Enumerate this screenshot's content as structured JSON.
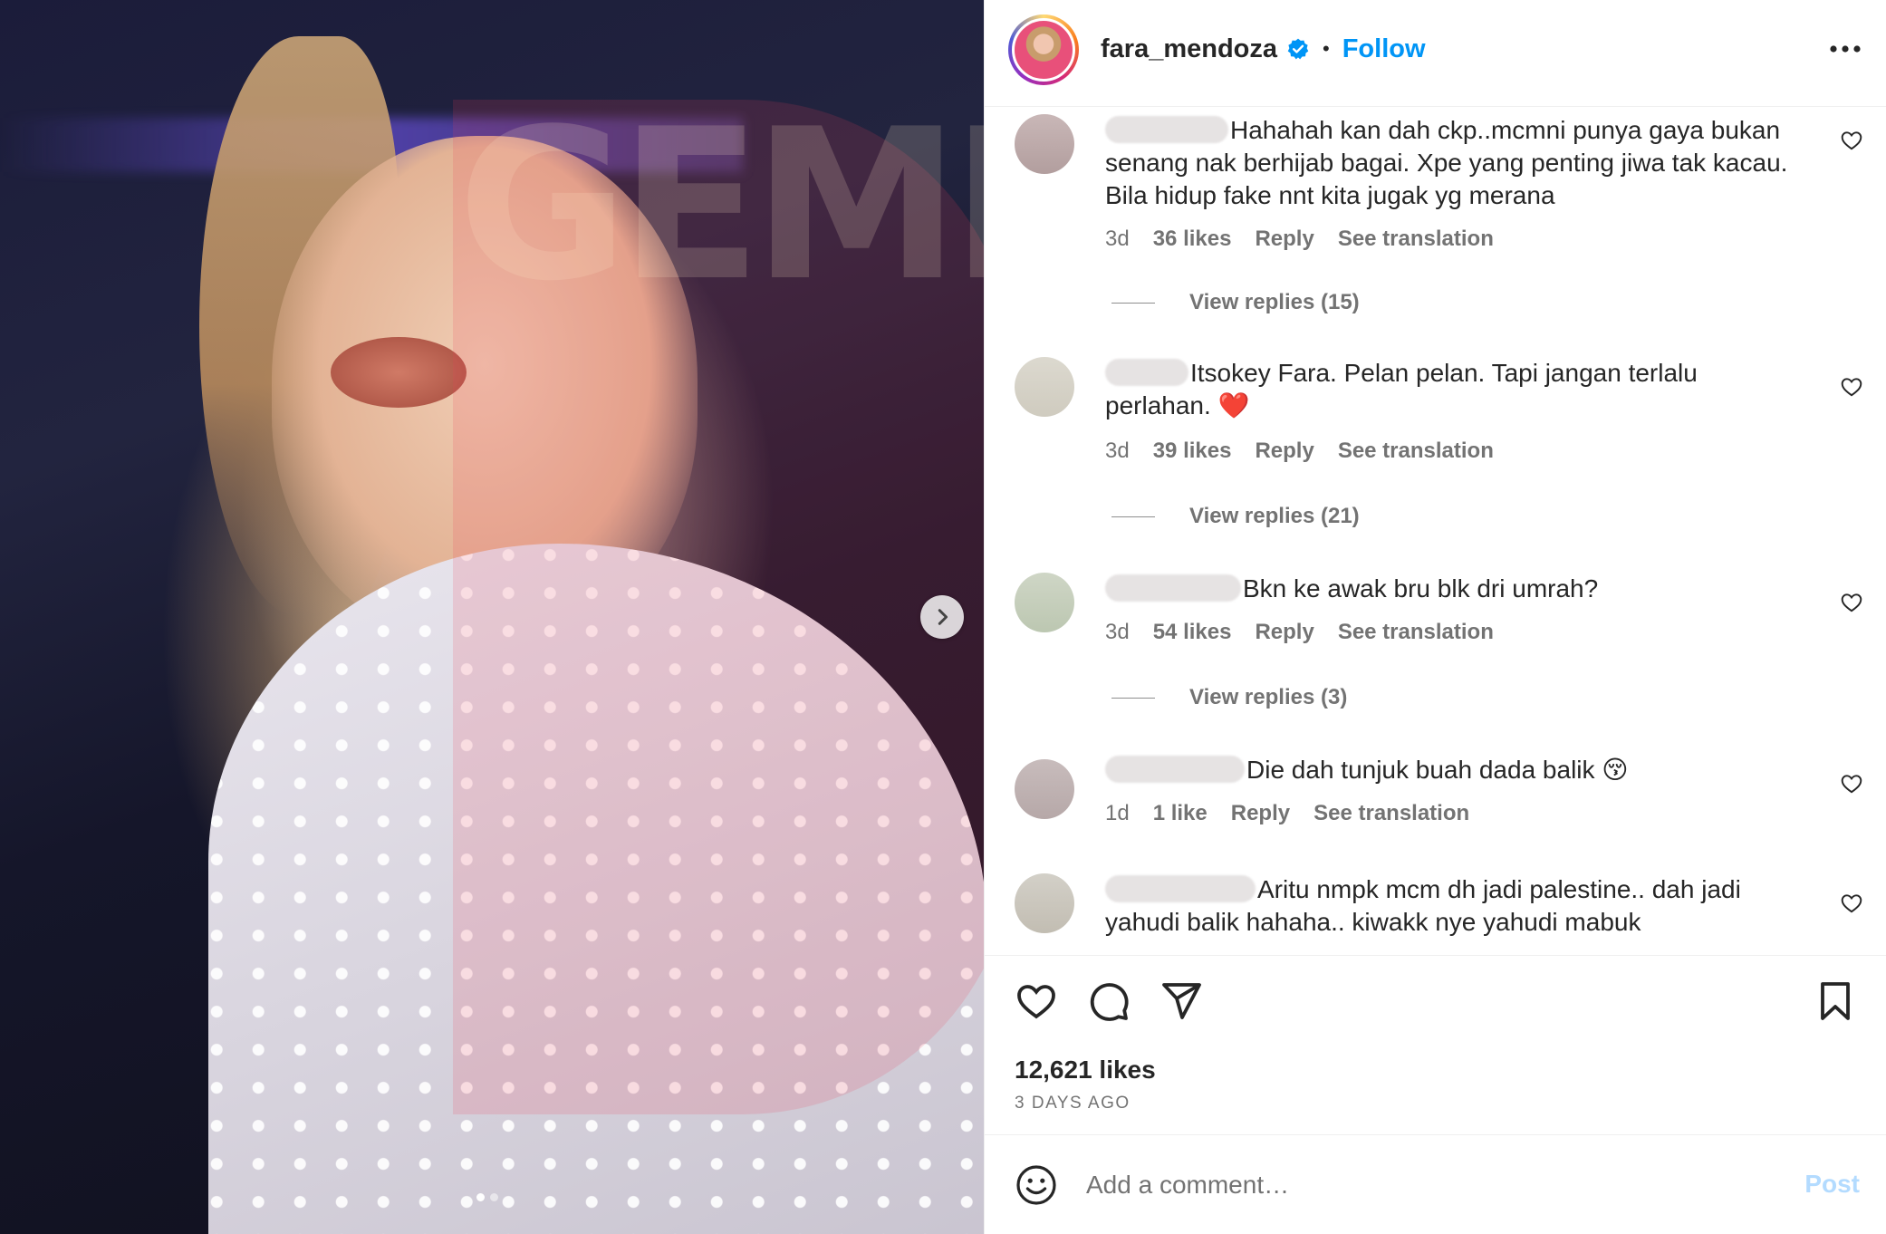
{
  "post": {
    "username": "fara_mendoza",
    "separator": "•",
    "follow_label": "Follow",
    "image_count": 2,
    "active_image": 1
  },
  "comments": [
    {
      "text": "Hahahah kan dah ckp..mcmni punya gaya bukan senang nak berhijab bagai. Xpe yang penting jiwa tak kacau. Bila hidup fake nnt kita jugak yg merana",
      "time": "3d",
      "likes": "36 likes",
      "reply": "Reply",
      "translate": "See translation",
      "view_replies": "View replies (15)"
    },
    {
      "text": "Itsokey Fara. Pelan pelan. Tapi jangan terlalu perlahan.",
      "emoji": "❤️",
      "time": "3d",
      "likes": "39 likes",
      "reply": "Reply",
      "translate": "See translation",
      "view_replies": "View replies (21)"
    },
    {
      "text": "Bkn ke awak bru blk dri umrah?",
      "time": "3d",
      "likes": "54 likes",
      "reply": "Reply",
      "translate": "See translation",
      "view_replies": "View replies (3)"
    },
    {
      "text": "Die dah tunjuk buah dada balik",
      "emoji": "😚",
      "time": "1d",
      "likes": "1 like",
      "reply": "Reply",
      "translate": "See translation"
    },
    {
      "text": "Aritu nmpk mcm dh jadi palestine.. dah jadi yahudi balik hahaha.. kiwakk nye yahudi mabuk"
    }
  ],
  "actions": {
    "like_icon": "heart-icon",
    "comment_icon": "comment-icon",
    "share_icon": "share-icon",
    "save_icon": "bookmark-icon"
  },
  "likes_total": "12,621 likes",
  "posted": "3 DAYS AGO",
  "comment_box": {
    "placeholder": "Add a comment…",
    "post_label": "Post"
  },
  "colors": {
    "accent": "#0095f6",
    "muted": "#737373",
    "post_disabled": "#b3dbff"
  }
}
